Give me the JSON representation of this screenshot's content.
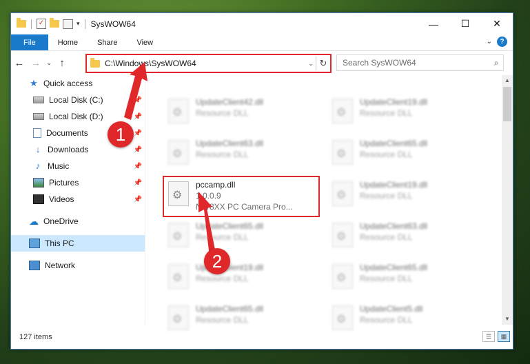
{
  "window": {
    "title": "SysWOW64",
    "controls": {
      "minimize": "—",
      "maximize": "☐",
      "close": "✕"
    }
  },
  "ribbon": {
    "tabs": [
      "File",
      "Home",
      "Share",
      "View"
    ],
    "expand_glyph": "⌄",
    "help_glyph": "?"
  },
  "nav_buttons": {
    "back": "←",
    "forward": "→",
    "recent": "⌄",
    "up": "↑"
  },
  "address": {
    "path": "C:\\Windows\\SysWOW64",
    "dropdown_glyph": "⌄",
    "refresh_glyph": "↻"
  },
  "search": {
    "placeholder": "Search SysWOW64",
    "icon": "search-icon"
  },
  "sidebar": {
    "quick_access": "Quick access",
    "items": [
      {
        "label": "Local Disk (C:)",
        "icon": "disk-icon"
      },
      {
        "label": "Local Disk (D:)",
        "icon": "disk-icon"
      },
      {
        "label": "Documents",
        "icon": "documents-icon"
      },
      {
        "label": "Downloads",
        "icon": "downloads-icon"
      },
      {
        "label": "Music",
        "icon": "music-icon"
      },
      {
        "label": "Pictures",
        "icon": "pictures-icon"
      },
      {
        "label": "Videos",
        "icon": "videos-icon"
      }
    ],
    "onedrive": "OneDrive",
    "this_pc": "This PC",
    "network": "Network"
  },
  "files": [
    {
      "name": "UpdateClient42.dll",
      "desc": "Resource DLL",
      "blurred": true
    },
    {
      "name": "UpdateClient19.dll",
      "desc": "Resource DLL",
      "blurred": true
    },
    {
      "name": "UpdateClient63.dll",
      "desc": "Resource DLL",
      "blurred": true
    },
    {
      "name": "UpdateClient65.dll",
      "desc": "Resource DLL",
      "blurred": true
    },
    {
      "name": "pccamp.dll",
      "version": "1.0.0.9",
      "desc": "NW8XX PC Camera Pro...",
      "blurred": false
    },
    {
      "name": "UpdateClient19.dll",
      "desc": "Resource DLL",
      "blurred": true
    },
    {
      "name": "UpdateClient65.dll",
      "desc": "Resource DLL",
      "blurred": true
    },
    {
      "name": "UpdateClient63.dll",
      "desc": "Resource DLL",
      "blurred": true
    },
    {
      "name": "UpdateClient19.dll",
      "desc": "Resource DLL",
      "blurred": true
    },
    {
      "name": "UpdateClient65.dll",
      "desc": "Resource DLL",
      "blurred": true
    },
    {
      "name": "UpdateClient65.dll",
      "desc": "Resource DLL",
      "blurred": true
    },
    {
      "name": "UpdateClient5.dll",
      "desc": "Resource DLL",
      "blurred": true
    }
  ],
  "status": {
    "count": "127 items"
  },
  "callouts": [
    "1",
    "2"
  ],
  "colors": {
    "accent": "#1979ca",
    "highlight": "#e0282a",
    "selected": "#cce8ff"
  }
}
